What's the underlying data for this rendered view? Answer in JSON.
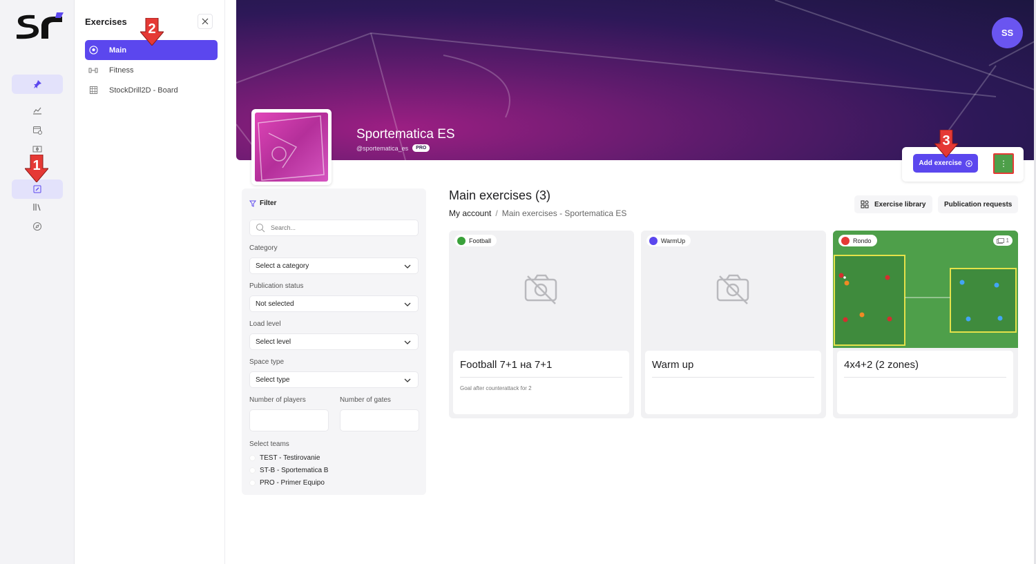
{
  "app": {
    "logo_text": "SF"
  },
  "rail": {
    "items": [
      "pin-icon",
      "chart-icon",
      "calendar-icon",
      "field-icon",
      "edit-icon",
      "library-icon",
      "compass-icon"
    ],
    "active_index": 4
  },
  "subpanel": {
    "title": "Exercises",
    "items": [
      {
        "label": "Main",
        "icon": "soccer-ball-icon",
        "active": true
      },
      {
        "label": "Fitness",
        "icon": "dumbbell-icon",
        "active": false
      },
      {
        "label": "StockDrill2D - Board",
        "icon": "grid-board-icon",
        "active": false
      }
    ]
  },
  "profile": {
    "name": "Sportematica ES",
    "handle": "@sportematica_es",
    "badge": "PRO",
    "avatar_initials": "SS"
  },
  "actions": {
    "add_label": "Add exercise",
    "more_symbol": "⋮"
  },
  "filter": {
    "title": "Filter",
    "search_placeholder": "Search...",
    "category_label": "Category",
    "category_value": "Select a category",
    "status_label": "Publication status",
    "status_value": "Not selected",
    "load_label": "Load level",
    "load_value": "Select level",
    "space_label": "Space type",
    "space_value": "Select type",
    "players_label": "Number of players",
    "gates_label": "Number of gates",
    "teams_label": "Select teams",
    "teams": [
      "TEST - Testirovanie",
      "ST-B - Sportematica B",
      "PRO - Primer Equipo"
    ]
  },
  "main": {
    "title": "Main exercises (3)",
    "breadcrumb": [
      "My account",
      "Main exercises - Sportematica ES"
    ],
    "breadcrumb_sep": "/",
    "library_label": "Exercise library",
    "requests_label": "Publication requests",
    "cards": [
      {
        "category": "Football",
        "color": "#3aa13a",
        "title": "Football 7+1 на 7+1",
        "description": "Goal after counterattack for 2",
        "has_image": false
      },
      {
        "category": "WarmUp",
        "color": "#5b47ee",
        "title": "Warm up",
        "description": "",
        "has_image": false
      },
      {
        "category": "Rondo",
        "color": "#e53935",
        "title": "4x4+2 (2 zones)",
        "description": "",
        "has_image": true,
        "image_count": "1"
      }
    ]
  },
  "annotations": [
    "1",
    "2",
    "3"
  ],
  "colors": {
    "accent": "#5b47ee",
    "annotation_red": "#e53935",
    "field_green": "#4e9f4a"
  }
}
